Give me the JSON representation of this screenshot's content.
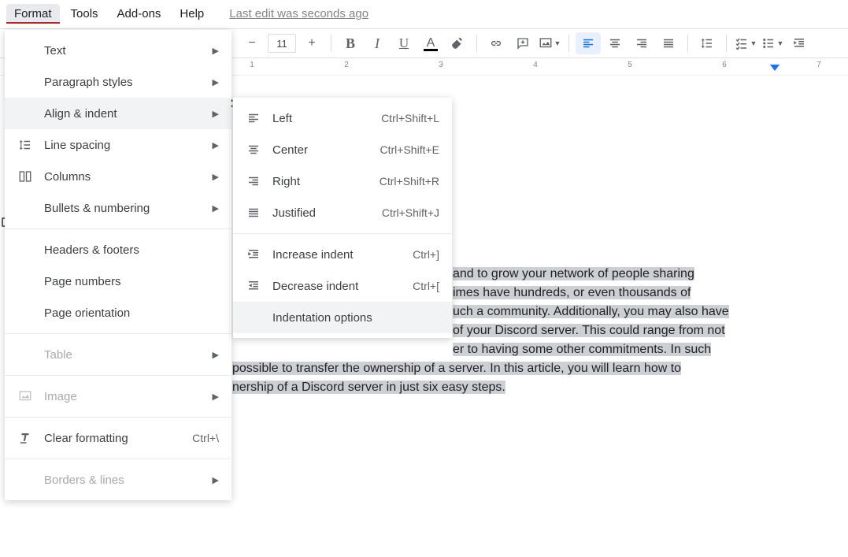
{
  "menubar": {
    "format": "Format",
    "tools": "Tools",
    "addons": "Add-ons",
    "help": "Help",
    "last_edit": "Last edit was seconds ago"
  },
  "toolbar": {
    "font_size": "11",
    "bold": "B",
    "italic": "I",
    "underline": "U",
    "text_color": "A"
  },
  "ruler": {
    "n1": "1",
    "n2": "2",
    "n3": "3",
    "n4": "4",
    "n5": "5",
    "n6": "6",
    "n7": "7"
  },
  "format_menu": {
    "text": "Text",
    "paragraph_styles": "Paragraph styles",
    "align_indent": "Align & indent",
    "line_spacing": "Line spacing",
    "columns": "Columns",
    "bullets_numbering": "Bullets & numbering",
    "headers_footers": "Headers & footers",
    "page_numbers": "Page numbers",
    "page_orientation": "Page orientation",
    "table": "Table",
    "image": "Image",
    "clear_formatting": "Clear formatting",
    "clear_formatting_short": "Ctrl+\\",
    "borders_lines": "Borders & lines"
  },
  "align_submenu": {
    "left": "Left",
    "left_short": "Ctrl+Shift+L",
    "center": "Center",
    "center_short": "Ctrl+Shift+E",
    "right": "Right",
    "right_short": "Ctrl+Shift+R",
    "justified": "Justified",
    "justified_short": "Ctrl+Shift+J",
    "increase_indent": "Increase indent",
    "increase_indent_short": "Ctrl+]",
    "decrease_indent": "Decrease indent",
    "decrease_indent_short": "Ctrl+[",
    "indentation_options": "Indentation options"
  },
  "doc": {
    "heading_tail": "n:",
    "l1a": "and to grow your network of people sharing",
    "l2a": "imes have hundreds, or even thousands of",
    "l3a": "uch a community. Additionally, you may also have",
    "l4a": " of your Discord server. This could range from not",
    "l5a": "er to having some other commitments. In such",
    "l6a": "possible to transfer the ownership of a server. In this article, you will learn how to",
    "l7a": "nership of a Discord server in just six easy steps."
  }
}
